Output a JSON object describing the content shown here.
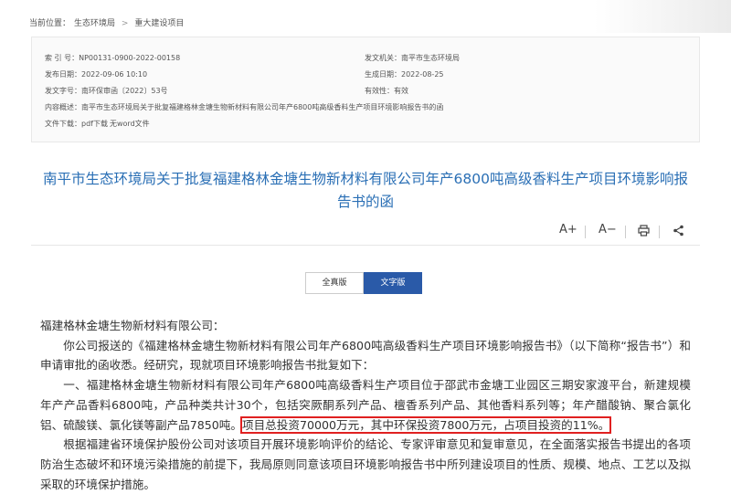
{
  "breadcrumb": {
    "current_label": "当前位置：",
    "items": [
      "生态环境局",
      "重大建设项目"
    ],
    "separator": ">"
  },
  "meta": {
    "index_label": "索 引 号：",
    "index_value": "NP00131-0900-2022-00158",
    "issuer_label": "发文机关：",
    "issuer_value": "南平市生态环境局",
    "publish_label": "发布日期：",
    "publish_value": "2022-09-06 10:10",
    "created_label": "生成日期：",
    "created_value": "2022-08-25",
    "doc_no_label": "发文字号：",
    "doc_no_value": "南环保审函〔2022〕53号",
    "validity_label": "有效性：",
    "validity_value": "有效",
    "summary_label": "内容概述：",
    "summary_value": "南平市生态环境局关于批复福建格林金塘生物新材料有限公司年产6800吨高级香料生产项目环境影响报告书的函",
    "download_label": "文件下载：",
    "download_pdf": "pdf下载",
    "download_word": "无word文件"
  },
  "title": "南平市生态环境局关于批复福建格林金塘生物新材料有限公司年产6800吨高级香料生产项目环境影响报告书的函",
  "toolbar": {
    "font_increase": "A+",
    "font_decrease": "A−",
    "print_icon": "printer-icon",
    "share_icon": "share-icon"
  },
  "tabs": {
    "full": "全真版",
    "text": "文字版"
  },
  "body": {
    "salutation": "福建格林金塘生物新材料有限公司：",
    "p1": "你公司报送的《福建格林金塘生物新材料有限公司年产6800吨高级香料生产项目环境影响报告书》（以下简称“报告书”）和申请审批的函收悉。经研究，现就项目环境影响报告书批复如下：",
    "p2_start": "一、福建格林金塘生物新材料有限公司年产6800吨高级香料生产项目位于邵武市金塘工业园区三期安家渡平台，新建规模年产产品香料6800吨，产品种类共计30个，包括突厥酮系列产品、檀香系列产品、其他香料系列等；年产醋酸钠、聚合氯化铝、硫酸镁、氯化镁等副产品7850吨。",
    "p2_highlight": "项目总投资70000万元，其中环保投资7800万元，占项目投资的11%。",
    "p3": "根据福建省环境保护股份公司对该项目开展环境影响评价的结论、专家评审意见和复审意见，在全面落实报告书提出的各项防治生态破坏和环境污染措施的前提下，我局原则同意该项目环境影响报告书中所列建设项目的性质、规模、地点、工艺以及拟采取的环境保护措施。"
  },
  "colors": {
    "title": "#2a6fb5",
    "active_tab": "#2a5aa8",
    "highlight_border": "#e02020"
  }
}
